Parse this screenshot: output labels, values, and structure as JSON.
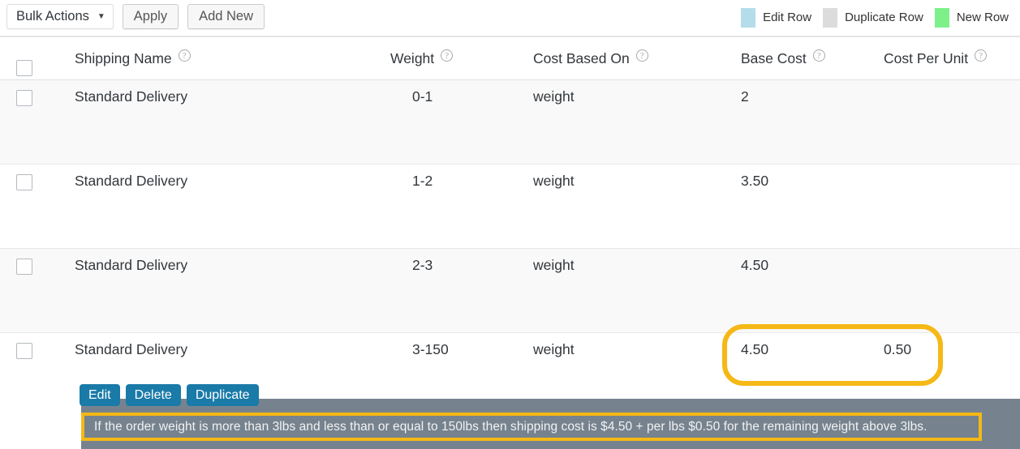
{
  "toolbar": {
    "bulk_actions_label": "Bulk Actions",
    "bulk_actions_caret": "▼",
    "apply_label": "Apply",
    "add_new_label": "Add New",
    "legend": [
      {
        "label": "Edit Row",
        "color": "#b5dcea"
      },
      {
        "label": "Duplicate Row",
        "color": "#dcdcdc"
      },
      {
        "label": "New Row",
        "color": "#7ef08a"
      }
    ]
  },
  "table": {
    "help_glyph": "?",
    "columns": [
      {
        "key": "checkbox",
        "label": ""
      },
      {
        "key": "shipping_name",
        "label": "Shipping Name",
        "help": true
      },
      {
        "key": "weight",
        "label": "Weight",
        "help": true
      },
      {
        "key": "cost_based_on",
        "label": "Cost Based On",
        "help": true
      },
      {
        "key": "base_cost",
        "label": "Base Cost",
        "help": true
      },
      {
        "key": "cost_per_unit",
        "label": "Cost Per Unit",
        "help": true
      }
    ],
    "rows": [
      {
        "shipping_name": "Standard Delivery",
        "weight": "0-1",
        "cost_based_on": "weight",
        "base_cost": "2",
        "cost_per_unit": ""
      },
      {
        "shipping_name": "Standard Delivery",
        "weight": "1-2",
        "cost_based_on": "weight",
        "base_cost": "3.50",
        "cost_per_unit": ""
      },
      {
        "shipping_name": "Standard Delivery",
        "weight": "2-3",
        "cost_based_on": "weight",
        "base_cost": "4.50",
        "cost_per_unit": ""
      },
      {
        "shipping_name": "Standard Delivery",
        "weight": "3-150",
        "cost_based_on": "weight",
        "base_cost": "4.50",
        "cost_per_unit": "0.50"
      }
    ]
  },
  "row_actions": {
    "edit_label": "Edit",
    "delete_label": "Delete",
    "duplicate_label": "Duplicate"
  },
  "tooltip": {
    "text": "If the order weight is more than 3lbs and less than or equal to 150lbs then shipping cost is $4.50 + per lbs $0.50 for the remaining weight above 3lbs."
  },
  "highlight": {
    "color": "#f5b816"
  }
}
